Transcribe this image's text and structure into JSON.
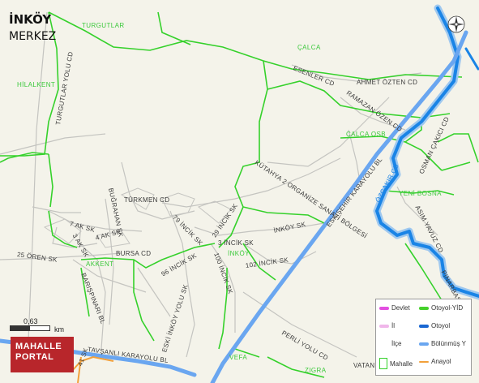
{
  "title": "İNKÖY",
  "subtitle": "MERKEZ",
  "logo": {
    "line1": "MAHALLE",
    "line2": "PORTAL"
  },
  "scale": {
    "value": "0,63",
    "unit": "km"
  },
  "compass_icon": "compass-icon",
  "colors": {
    "background": "#f4f3ea",
    "mahalle_border": "#35d12b",
    "river": "#1a84e6",
    "river_outline": "#9fc8ef",
    "highway": "#6aa6f0",
    "arterial": "#f2a03a",
    "minor_road": "#b9b9b9",
    "label_mahalle": "#3cc83c",
    "logo_bg": "#b8262b"
  },
  "mahalle_labels": [
    "TURGUTLAR",
    "HİLALKENT",
    "ÇALCA",
    "ÇALCA OSB",
    "YENİ BOSNA",
    "AKKENT",
    "İNKÖY",
    "VEFA",
    "ZIGRA"
  ],
  "road_labels": [
    "TURGUTLAR YOLU CD",
    "ESENLER CD",
    "AHMET ÖZTEN CD",
    "RAMAZAN ÖZEN CD",
    "KÜTAHYA 2 ORGANİZE SANAYİ BÖLGESİ",
    "ESKİŞEHİR KARAYOLU BL",
    "ÖZÇAKIR CD",
    "OSMAN ÇAKICI CD",
    "ASIM YAVUZ CD",
    "BUĞRAHAN SK",
    "TÜRKMEN CD",
    "7 AK SK",
    "3 AK SK",
    "4 AK SK",
    "25 ÖREN SK",
    "BURSA CD",
    "79 İNCİK SK",
    "29 İNCİK SK",
    "3 İNCİK SK",
    "İNKÖY SK",
    "96 İNCİK SK",
    "100 İNCİK SK",
    "102 İNCİK SK",
    "BARIŞPINARI BL",
    "ESKİ İNKÖY YOLU SK",
    "PERLİ YOLU CD",
    "TAVŞANLI KARAYOLU BL",
    "41 SK",
    "VATAN",
    "PINARBAŞ"
  ],
  "legend": {
    "items": [
      {
        "label": "Devlet",
        "color": "#e24fe0"
      },
      {
        "label": "Otoyol-YİD",
        "color": "#45d12b"
      },
      {
        "label": "İl",
        "color": "#f0b6ea"
      },
      {
        "label": "Otoyol",
        "color": "#1967d2"
      },
      {
        "label": "İlçe",
        "color": "#ffffff"
      },
      {
        "label": "Bölünmüş Y",
        "color": "#6aa6f0"
      },
      {
        "label": "Mahalle",
        "color": "#ffffff"
      },
      {
        "label": "Anayol",
        "color": "#f2a03a"
      }
    ]
  }
}
